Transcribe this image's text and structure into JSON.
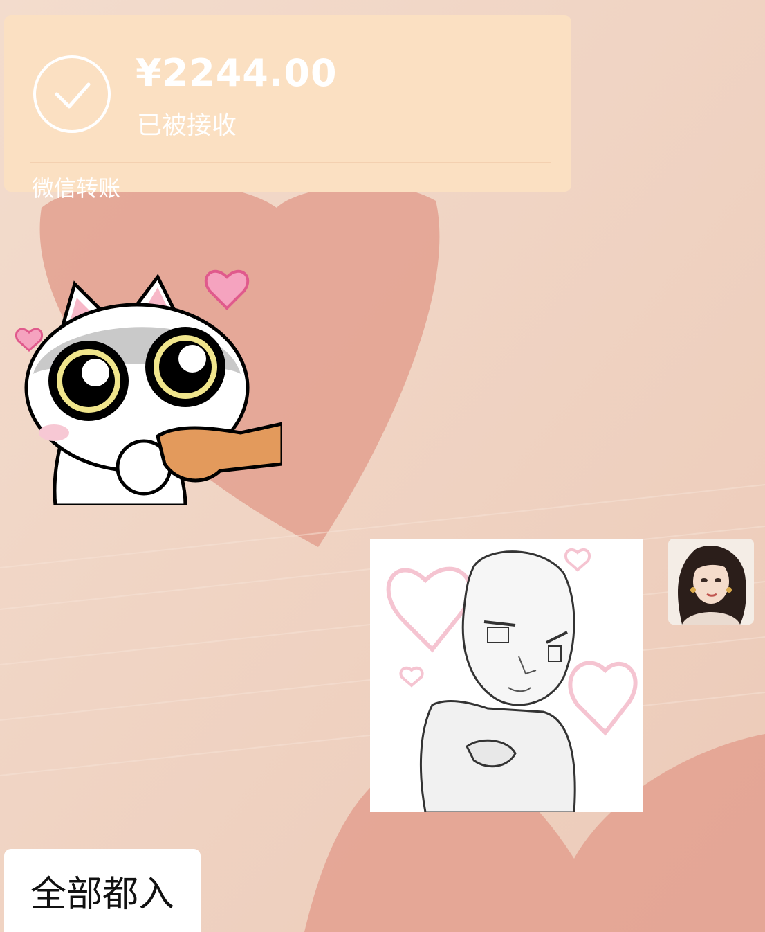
{
  "transfer": {
    "amount": "¥2244.00",
    "status": "已被接收",
    "source": "微信转账",
    "icon": "check-icon"
  },
  "messages": [
    {
      "type": "sticker",
      "side": "left",
      "icon": "cat-hearts-sticker"
    },
    {
      "type": "sticker",
      "side": "right",
      "icon": "sketch-man-hearts-sticker"
    },
    {
      "type": "text",
      "side": "left",
      "text": "全部都入"
    }
  ],
  "colors": {
    "background": "#f2d6c6",
    "heart": "#e3a08f",
    "transfer_card": "#fbe0c2"
  }
}
